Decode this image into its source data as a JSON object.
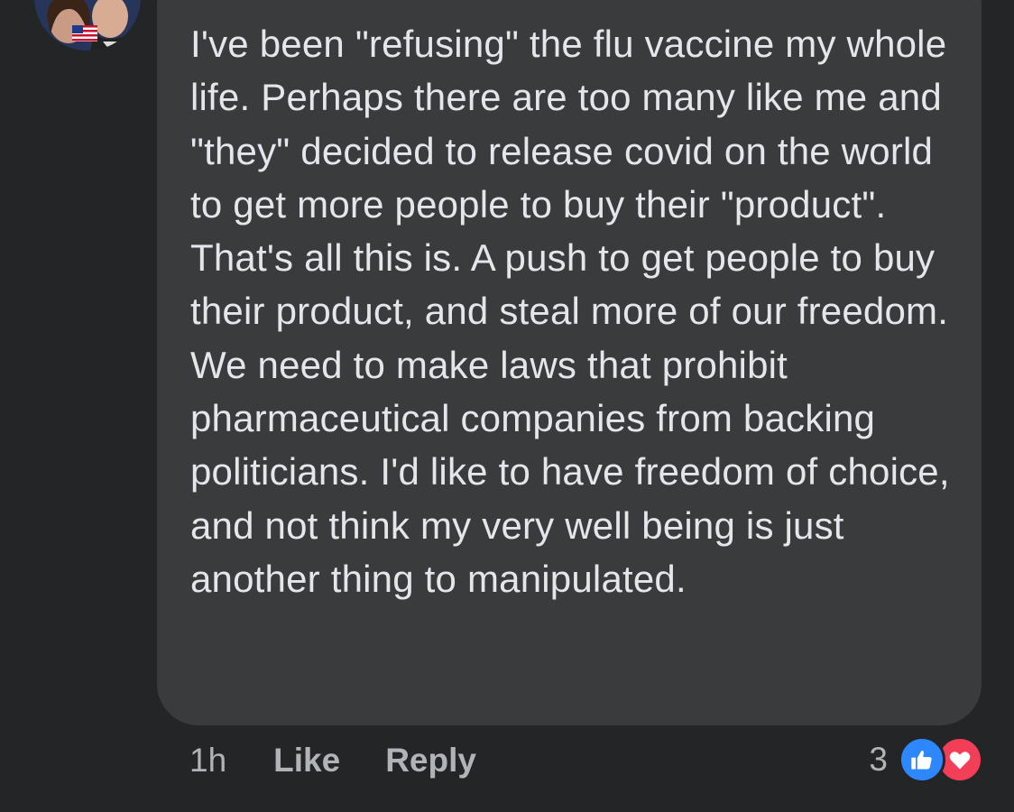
{
  "comment": {
    "text": "I've been \"refusing\" the flu vaccine my whole life. Perhaps there are too many like me and \"they\" decided to release covid on the world to get more people to buy their \"product\". That's all this is. A push to get people to buy their product, and steal more of our freedom. We need to make laws that prohibit pharmaceutical companies from backing politicians. I'd like to have freedom of choice, and not think my very well being is just another thing to manipulated."
  },
  "actions": {
    "timestamp": "1h",
    "like_label": "Like",
    "reply_label": "Reply"
  },
  "reactions": {
    "count": "3",
    "types": [
      "like-icon",
      "love-icon"
    ],
    "like_color": "#2d88ff",
    "love_color": "#f33e58"
  },
  "colors": {
    "background": "#242526",
    "bubble": "#3a3b3c",
    "text": "#e4e6eb",
    "secondary_text": "#b0b3b8"
  }
}
